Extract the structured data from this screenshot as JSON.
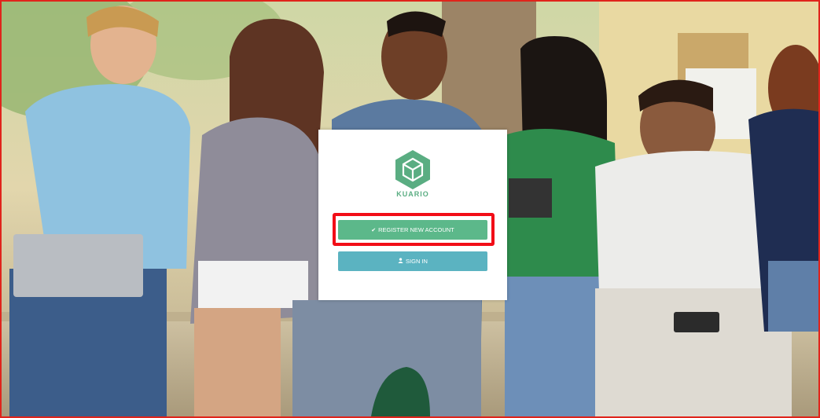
{
  "brand": {
    "name": "KUARIO",
    "color": "#5aad82"
  },
  "buttons": {
    "register": {
      "label": "REGISTER NEW ACCOUNT",
      "icon": "check-icon",
      "color": "#5cb88a"
    },
    "signin": {
      "label": "SIGN IN",
      "icon": "user-icon",
      "color": "#5bb3c1"
    }
  },
  "highlight_color": "#f20d17",
  "background": {
    "description_icon": "students-photo"
  }
}
